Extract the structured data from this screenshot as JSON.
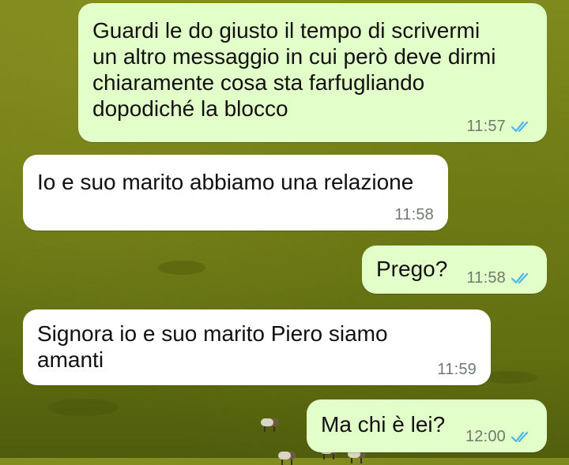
{
  "theme": {
    "outgoing_bubble": "#e2fec9",
    "incoming_bubble": "#ffffff",
    "read_tick_color": "#4fb6ec",
    "wallpaper": "olive-green grassland"
  },
  "messages": [
    {
      "direction": "outgoing",
      "text": "Guardi le do giusto il tempo di scrivermi\nun altro messaggio in cui però deve dirmi\nchiaramente cosa sta farfugliando\ndopodiché la blocco",
      "time": "11:57",
      "status_icon": "double-check-read-icon"
    },
    {
      "direction": "incoming",
      "text": "Io e suo marito abbiamo una relazione",
      "time": "11:58"
    },
    {
      "direction": "outgoing",
      "text": "Prego?",
      "time": "11:58",
      "status_icon": "double-check-read-icon"
    },
    {
      "direction": "incoming",
      "text": "Signora io e suo marito Piero siamo\namanti",
      "time": "11:59"
    },
    {
      "direction": "outgoing",
      "text": "Ma chi è lei?",
      "time": "12:00",
      "status_icon": "double-check-read-icon"
    }
  ]
}
